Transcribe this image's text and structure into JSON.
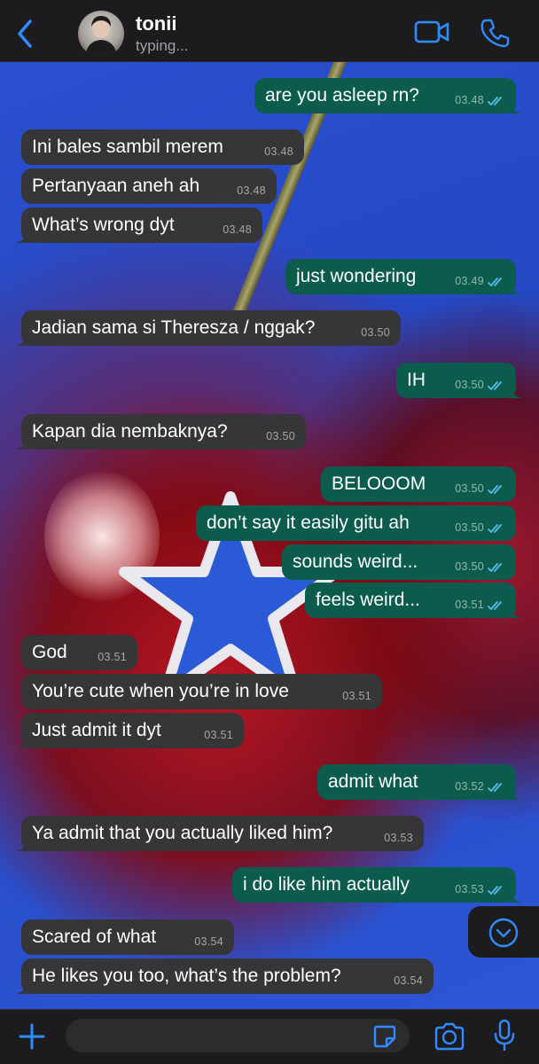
{
  "header": {
    "contact_name": "tonii",
    "status": "typing...",
    "back_icon": "chevron-left-icon",
    "video_icon": "video-camera-icon",
    "call_icon": "phone-icon",
    "accent_color": "#2f8cff"
  },
  "messages": [
    {
      "dir": "out",
      "text": "are you asleep rn?",
      "time": "03.48"
    },
    {
      "dir": "in",
      "text": "Ini bales sambil merem",
      "time": "03.48"
    },
    {
      "dir": "in",
      "text": "Pertanyaan aneh ah",
      "time": "03.48"
    },
    {
      "dir": "in",
      "text": "What’s wrong dyt",
      "time": "03.48"
    },
    {
      "dir": "out",
      "text": "just wondering",
      "time": "03.49"
    },
    {
      "dir": "in",
      "text": "Jadian sama si Theresza / nggak?",
      "time": "03.50"
    },
    {
      "dir": "out",
      "text": "IH",
      "time": "03.50"
    },
    {
      "dir": "in",
      "text": "Kapan dia nembaknya?",
      "time": "03.50"
    },
    {
      "dir": "out",
      "text": "BELOOOM",
      "time": "03.50"
    },
    {
      "dir": "out",
      "text": "don’t say it easily gitu ah",
      "time": "03.50"
    },
    {
      "dir": "out",
      "text": "sounds weird...",
      "time": "03.50"
    },
    {
      "dir": "out",
      "text": "feels weird...",
      "time": "03.51"
    },
    {
      "dir": "in",
      "text": "God",
      "time": "03.51"
    },
    {
      "dir": "in",
      "text": "You’re cute when you’re in love",
      "time": "03.51"
    },
    {
      "dir": "in",
      "text": "Just admit it dyt",
      "time": "03.51"
    },
    {
      "dir": "out",
      "text": "admit what",
      "time": "03.52"
    },
    {
      "dir": "in",
      "text": "Ya admit that you actually liked him?",
      "time": "03.53"
    },
    {
      "dir": "out",
      "text": "i do like him actually",
      "time": "03.53"
    },
    {
      "dir": "in",
      "text": "Scared of what",
      "time": "03.54"
    },
    {
      "dir": "in",
      "text": "He likes you too, what’s the problem?",
      "time": "03.54"
    }
  ],
  "colors": {
    "incoming_bubble": "#363638",
    "outgoing_bubble": "#0b5c4c",
    "read_ticks": "#53bdeb"
  },
  "input": {
    "placeholder": "",
    "plus_icon": "plus-icon",
    "sticker_icon": "sticker-icon",
    "camera_icon": "camera-icon",
    "mic_icon": "microphone-icon"
  },
  "scroll_icon": "chevron-down-circle-icon"
}
